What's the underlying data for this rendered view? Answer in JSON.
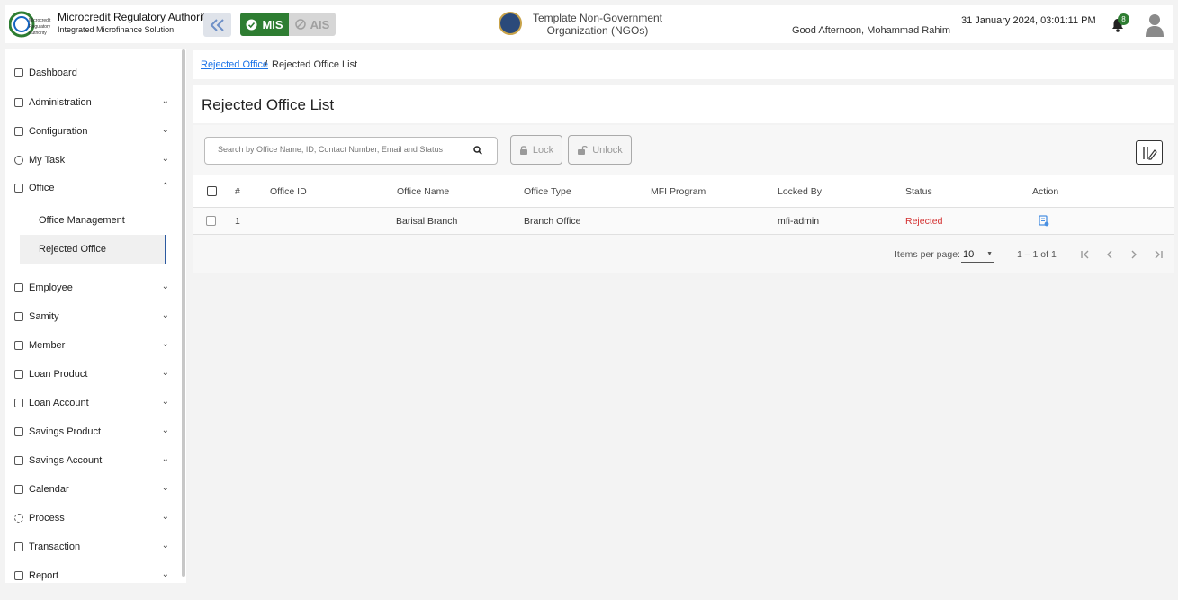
{
  "header": {
    "org_name": "Microcredit Regulatory Authority",
    "org_subtitle": "Integrated Microfinance Solution",
    "logo_text": [
      "Microcredit",
      "Regulatory",
      "Authority"
    ],
    "mode_mis": "MIS",
    "mode_ais": "AIS",
    "ngo_line1": "Template Non-Government",
    "ngo_line2": "Organization (NGOs)",
    "greeting": "Good Afternoon, Mohammad Rahim",
    "datetime": "31 January 2024, 03:01:11 PM",
    "notification_count": "8",
    "colors": {
      "mis_active": "#2e7d32",
      "link": "#1a73e8",
      "rejected": "#d32f2f"
    }
  },
  "sidebar": {
    "dashboard": "Dashboard",
    "items": [
      {
        "label": "Administration",
        "icon": "admin-icon",
        "expanded": false
      },
      {
        "label": "Configuration",
        "icon": "config-icon",
        "expanded": false
      },
      {
        "label": "My Task",
        "icon": "task-icon",
        "expanded": false
      },
      {
        "label": "Office",
        "icon": "office-icon",
        "expanded": true
      },
      {
        "label": "Employee",
        "icon": "employee-icon",
        "expanded": false
      },
      {
        "label": "Samity",
        "icon": "samity-icon",
        "expanded": false
      },
      {
        "label": "Member",
        "icon": "member-icon",
        "expanded": false
      },
      {
        "label": "Loan Product",
        "icon": "loan-product-icon",
        "expanded": false
      },
      {
        "label": "Loan Account",
        "icon": "loan-account-icon",
        "expanded": false
      },
      {
        "label": "Savings Product",
        "icon": "savings-product-icon",
        "expanded": false
      },
      {
        "label": "Savings Account",
        "icon": "savings-account-icon",
        "expanded": false
      },
      {
        "label": "Calendar",
        "icon": "calendar-icon",
        "expanded": false
      },
      {
        "label": "Process",
        "icon": "process-icon",
        "expanded": false
      },
      {
        "label": "Transaction",
        "icon": "transaction-icon",
        "expanded": false
      },
      {
        "label": "Report",
        "icon": "report-icon",
        "expanded": false
      }
    ],
    "office_sub": [
      "Office Management",
      "Rejected Office"
    ]
  },
  "breadcrumb": {
    "link": "Rejected Office",
    "separator": "/",
    "current": "Rejected Office List"
  },
  "page_title": "Rejected Office List",
  "toolbar": {
    "search_placeholder": "Search by Office Name, ID, Contact Number, Email and Status",
    "lock_label": "Lock",
    "unlock_label": "Unlock"
  },
  "table": {
    "columns": [
      "#",
      "Office ID",
      "Office Name",
      "Office Type",
      "MFI Program",
      "Locked By",
      "Status",
      "Action"
    ],
    "rows": [
      {
        "index": "1",
        "office_id": "",
        "office_name": "Barisal Branch",
        "office_type": "Branch Office",
        "mfi_program": "",
        "locked_by": "mfi-admin",
        "status": "Rejected"
      }
    ]
  },
  "paginator": {
    "items_per_page_label": "Items per page:",
    "items_per_page": "10",
    "range": "1 – 1 of 1"
  }
}
